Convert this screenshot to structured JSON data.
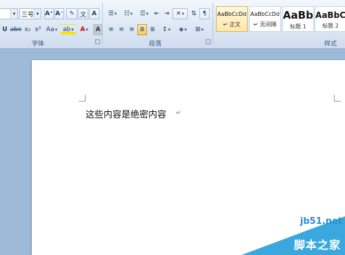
{
  "font_group": {
    "label": "字体",
    "size_value": "三号",
    "grow_font": "A⁺",
    "shrink_font": "A⁻",
    "strikethrough": "abe",
    "subscript": "x₂",
    "superscript": "x²",
    "change_case": "Aa",
    "text_highlight": "ab",
    "font_color": "A",
    "char_shading": "A",
    "enclose_char": "㊥"
  },
  "paragraph_group": {
    "label": "段落"
  },
  "styles_group": {
    "label": "样式",
    "tiles": [
      {
        "preview": "AaBbCcDd",
        "name": "↵ 正文"
      },
      {
        "preview": "AaBbCcDd",
        "name": "↵ 无间隔"
      },
      {
        "preview": "AaBb",
        "name": "标题 1"
      },
      {
        "preview": "AaBbC",
        "name": "标题 2"
      }
    ]
  },
  "document": {
    "text": "这些内容是绝密内容",
    "paragraph_mark": "↵"
  },
  "watermark": {
    "url": "jb51.net",
    "name": "脚本之家"
  }
}
